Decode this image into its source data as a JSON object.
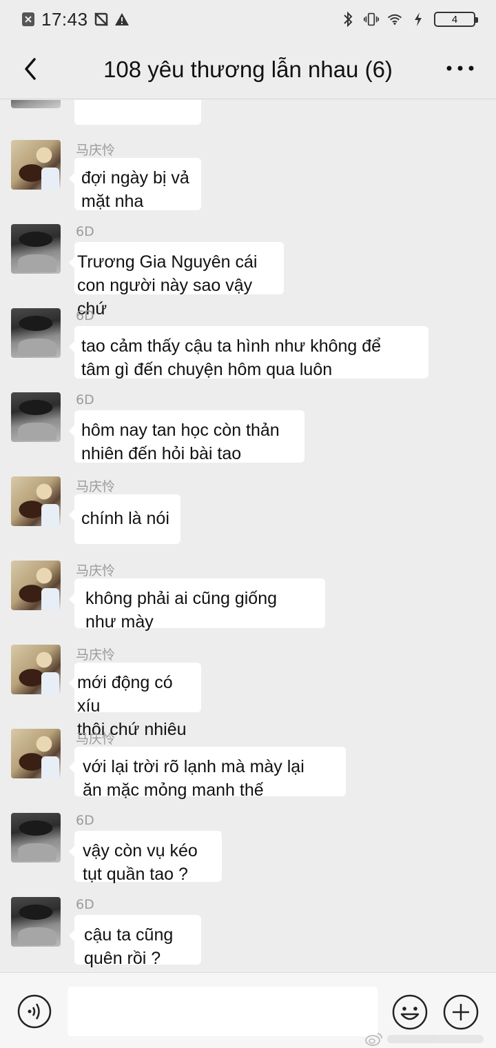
{
  "status_bar": {
    "time": "17:43",
    "battery_level": "4",
    "icons": [
      "sim-icon",
      "no-sync-icon",
      "warning-icon",
      "bluetooth-icon",
      "vibrate-icon",
      "wifi-icon",
      "charging-icon"
    ]
  },
  "header": {
    "title": "108 yêu thương lẫn nhau (6)",
    "back_icon": "chevron-left-icon",
    "more_icon": "more-dots-icon"
  },
  "messages": [
    {
      "sender": "马庆怜",
      "text": "đợi ngày bị vả\nmặt nha",
      "avatar": "ma"
    },
    {
      "sender": "6D",
      "text": "Trương Gia Nguyên cái\ncon người này sao vậy chứ",
      "avatar": "6d"
    },
    {
      "sender": "6D",
      "text": "tao cảm thấy cậu ta hình như không để\ntâm gì đến chuyện hôm qua luôn",
      "avatar": "6d"
    },
    {
      "sender": "6D",
      "text": "hôm nay tan học còn thản\nnhiên đến hỏi bài tao",
      "avatar": "6d"
    },
    {
      "sender": "马庆怜",
      "text": "chính là nói",
      "avatar": "ma"
    },
    {
      "sender": "马庆怜",
      "text": "không phải ai cũng giống\nnhư mày",
      "avatar": "ma"
    },
    {
      "sender": "马庆怜",
      "text": "mới động có xíu\nthôi chứ nhiêu",
      "avatar": "ma"
    },
    {
      "sender": "马庆怜",
      "text": "với lại trời rõ lạnh mà mày lại\năn mặc mỏng manh thế",
      "avatar": "ma"
    },
    {
      "sender": "6D",
      "text": "vậy còn vụ kéo\ntụt quần tao ?",
      "avatar": "6d"
    },
    {
      "sender": "6D",
      "text": "cậu ta cũng\nquên rồi ?",
      "avatar": "6d"
    }
  ],
  "input_bar": {
    "placeholder": "",
    "voice_icon": "voice-icon",
    "emoji_icon": "emoji-icon",
    "plus_icon": "plus-icon"
  },
  "colors": {
    "background": "#ededed",
    "bubble": "#ffffff",
    "sender_name": "#9b9b9b"
  }
}
